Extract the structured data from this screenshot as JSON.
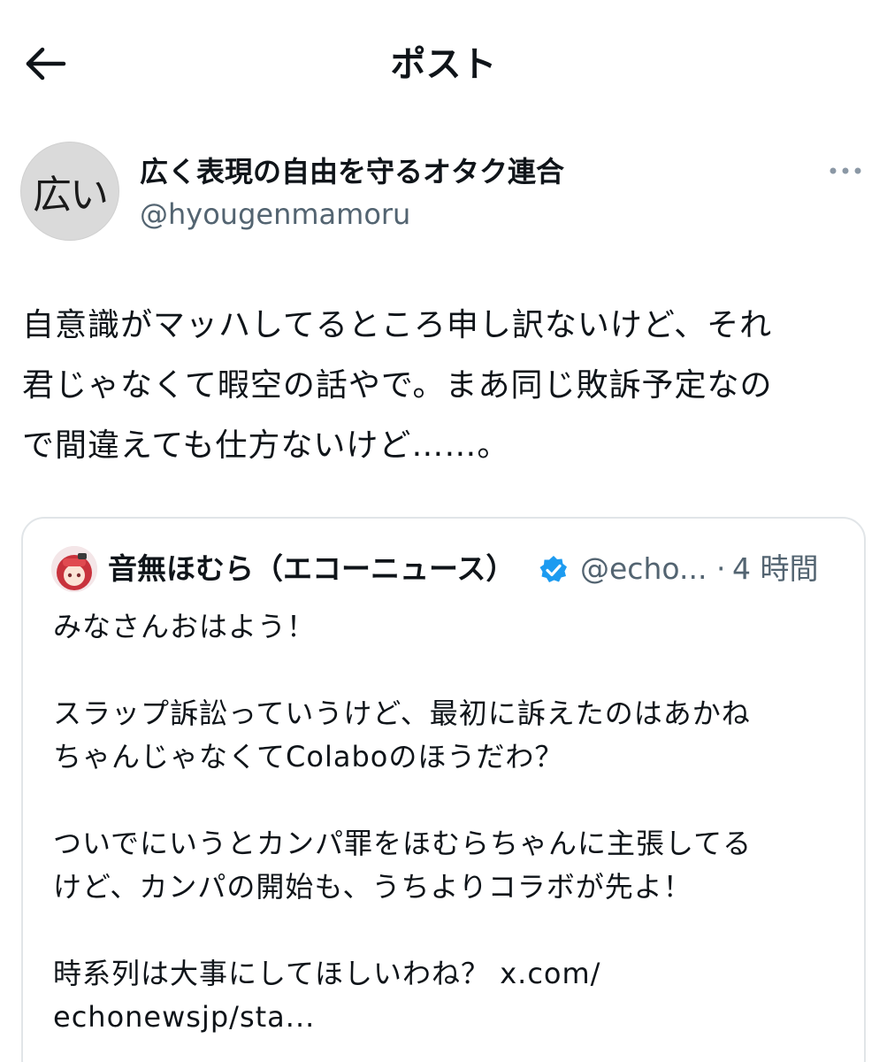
{
  "header": {
    "title": "ポスト",
    "back_icon": "back-arrow-icon"
  },
  "post": {
    "author": {
      "name": "広く表現の自由を守るオタク連合",
      "handle": "@hyougenmamoru",
      "avatar_text": "広い"
    },
    "more_icon": "more-dots-icon",
    "text": "自意識がマッハしてるところ申し訳ないけど、それ\n君じゃなくて暇空の話やで。まあ同じ敗訴予定なの\nで間違えても仕方ないけど……。"
  },
  "quote": {
    "author": {
      "name": "音無ほむら（エコーニュース）",
      "handle": "@echo...",
      "separator": "·",
      "time": "4 時間",
      "verified": true,
      "verified_color": "#1d9bf0"
    },
    "text": "みなさんおはよう！\n\nスラップ訴訟っていうけど、最初に訴えたのはあかね\nちゃんじゃなくてColaboのほうだわ？\n\nついでにいうとカンパ罪をほむらちゃんに主張してる\nけど、カンパの開始も、うちよりコラボが先よ！\n\n時系列は大事にしてほしいわね？ x.com/\nechonewsjp/sta..."
  },
  "colors": {
    "text_primary": "#0f1419",
    "text_secondary": "#536471",
    "border": "#e1e5e8",
    "accent": "#1d9bf0"
  }
}
